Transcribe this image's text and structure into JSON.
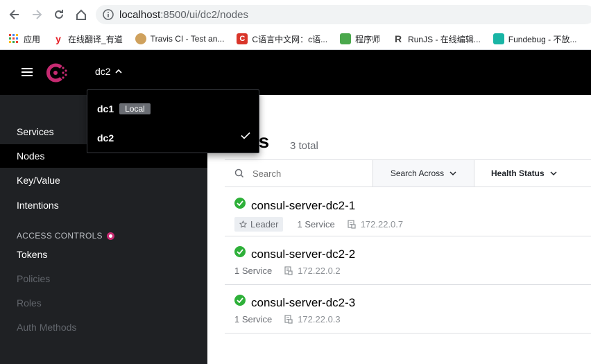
{
  "browser": {
    "url_host": "localhost",
    "url_path": ":8500/ui/dc2/nodes",
    "bookmarks": [
      {
        "label": "应用",
        "color": "#4285f4"
      },
      {
        "label": "在线翻译_有道",
        "color": "#e51b23"
      },
      {
        "label": "Travis CI - Test an...",
        "color": "#cfa15d"
      },
      {
        "label": "C语言中文网：c语...",
        "color": "#d9352a"
      },
      {
        "label": "程序师",
        "color": "#4aa84c"
      },
      {
        "label": "RunJS - 在线编辑...",
        "color": "#444444"
      },
      {
        "label": "Fundebug - 不放...",
        "color": "#19b5a5"
      }
    ]
  },
  "header": {
    "dc_label": "dc2"
  },
  "dc_menu": {
    "options": [
      {
        "name": "dc1",
        "badge": "Local"
      },
      {
        "name": "dc2",
        "badge": ""
      }
    ]
  },
  "sidebar": {
    "items": [
      {
        "label": "Services"
      },
      {
        "label": "Nodes"
      },
      {
        "label": "Key/Value"
      },
      {
        "label": "Intentions"
      }
    ],
    "access_heading": "ACCESS CONTROLS",
    "access_items": [
      {
        "label": "Tokens"
      },
      {
        "label": "Policies"
      },
      {
        "label": "Roles"
      },
      {
        "label": "Auth Methods"
      }
    ]
  },
  "main": {
    "title": "Nodes",
    "title_visible": "des",
    "count": "3 total",
    "search_placeholder": "Search",
    "search_across": "Search Across",
    "health_status": "Health Status",
    "nodes": [
      {
        "name": "consul-server-dc2-1",
        "leader": "Leader",
        "services": "1 Service",
        "ip": "172.22.0.7"
      },
      {
        "name": "consul-server-dc2-2",
        "leader": "",
        "services": "1 Service",
        "ip": "172.22.0.2"
      },
      {
        "name": "consul-server-dc2-3",
        "leader": "",
        "services": "1 Service",
        "ip": "172.22.0.3"
      }
    ]
  },
  "colors": {
    "brand": "#c62a71",
    "healthy": "#2eb039"
  }
}
